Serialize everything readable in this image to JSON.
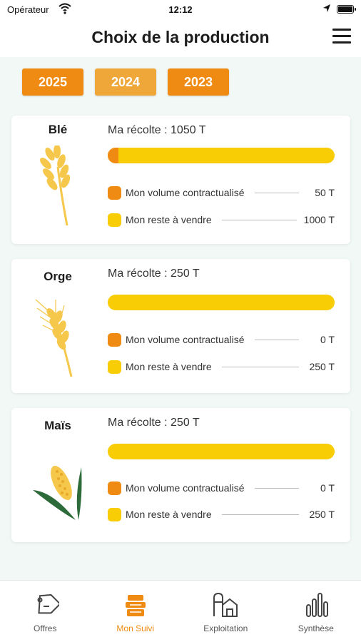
{
  "status_bar": {
    "carrier": "Opérateur",
    "time": "12:12"
  },
  "header": {
    "title": "Choix de la production"
  },
  "years": [
    {
      "label": "2025",
      "color": "#ef8a12"
    },
    {
      "label": "2024",
      "color": "#f0a73a"
    },
    {
      "label": "2023",
      "color": "#ef8a12"
    }
  ],
  "colors": {
    "contractualise": "#ef8a12",
    "reste": "#f9cd06",
    "background": "#f1f8f6"
  },
  "crops": [
    {
      "name": "Blé",
      "recolte": "Ma récolte : 1050 T",
      "contract_fraction": 0.048,
      "contract_label": "Mon volume contractualisé",
      "contract_value": "50 T",
      "reste_label": "Mon reste à vendre",
      "reste_value": "1000 T",
      "icon": "wheat-icon"
    },
    {
      "name": "Orge",
      "recolte": "Ma récolte : 250 T",
      "contract_fraction": 0,
      "contract_label": "Mon volume contractualisé",
      "contract_value": "0 T",
      "reste_label": "Mon reste à vendre",
      "reste_value": "250 T",
      "icon": "barley-icon"
    },
    {
      "name": "Maïs",
      "recolte": "Ma récolte : 250 T",
      "contract_fraction": 0,
      "contract_label": "Mon volume contractualisé",
      "contract_value": "0 T",
      "reste_label": "Mon reste à vendre",
      "reste_value": "250 T",
      "icon": "corn-icon"
    }
  ],
  "nav": [
    {
      "label": "Offres",
      "icon": "tag-icon",
      "active": false
    },
    {
      "label": "Mon Suivi",
      "icon": "stack-icon",
      "active": true
    },
    {
      "label": "Exploitation",
      "icon": "farm-icon",
      "active": false
    },
    {
      "label": "Synthèse",
      "icon": "bar-chart-icon",
      "active": false
    }
  ]
}
